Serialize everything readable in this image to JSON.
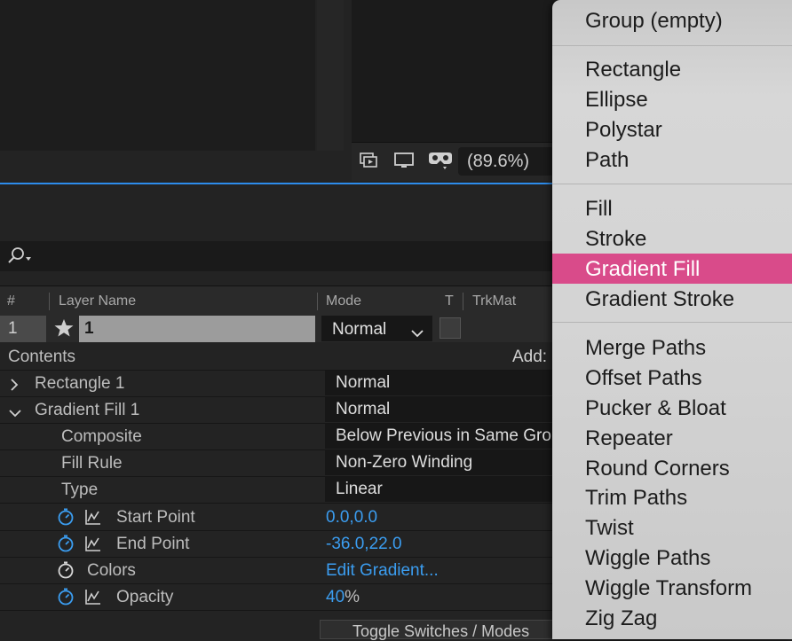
{
  "comp": {
    "zoom": "(89.6%)"
  },
  "columns": {
    "num": "#",
    "layer_name": "Layer Name",
    "mode": "Mode",
    "t": "T",
    "trkmat": "TrkMat"
  },
  "layer": {
    "number": "1",
    "name": "1",
    "mode": "Normal"
  },
  "contents": {
    "label": "Contents",
    "add_label": "Add:"
  },
  "properties": [
    {
      "label": "Rectangle 1",
      "value": "Normal"
    },
    {
      "label": "Gradient Fill 1",
      "value": "Normal"
    },
    {
      "label": "Composite",
      "value": "Below Previous in Same Group"
    },
    {
      "label": "Fill Rule",
      "value": "Non-Zero Winding"
    },
    {
      "label": "Type",
      "value": "Linear"
    },
    {
      "label": "Start Point",
      "value": "0.0,0.0"
    },
    {
      "label": "End Point",
      "value": "-36.0,22.0"
    },
    {
      "label": "Colors",
      "value": "Edit Gradient..."
    },
    {
      "label": "Opacity",
      "value": "40",
      "unit": "%"
    }
  ],
  "bottom_bar": {
    "label": "Toggle Switches / Modes"
  },
  "menu": {
    "items": [
      "Group (empty)",
      "Rectangle",
      "Ellipse",
      "Polystar",
      "Path",
      "Fill",
      "Stroke",
      "Gradient Fill",
      "Gradient Stroke",
      "Merge Paths",
      "Offset Paths",
      "Pucker & Bloat",
      "Repeater",
      "Round Corners",
      "Trim Paths",
      "Twist",
      "Wiggle Paths",
      "Wiggle Transform",
      "Zig Zag"
    ],
    "highlighted": "Gradient Fill"
  },
  "colors": {
    "accent_blue": "#2d8ceb",
    "value_blue": "#3b9df0",
    "menu_highlight": "#d94b8a"
  },
  "icons": [
    "search-icon",
    "star-icon",
    "stopwatch-icon",
    "graph-icon",
    "chevron-right-icon",
    "chevron-down-icon",
    "preview-icon",
    "monitor-icon",
    "vr-goggles-icon"
  ]
}
